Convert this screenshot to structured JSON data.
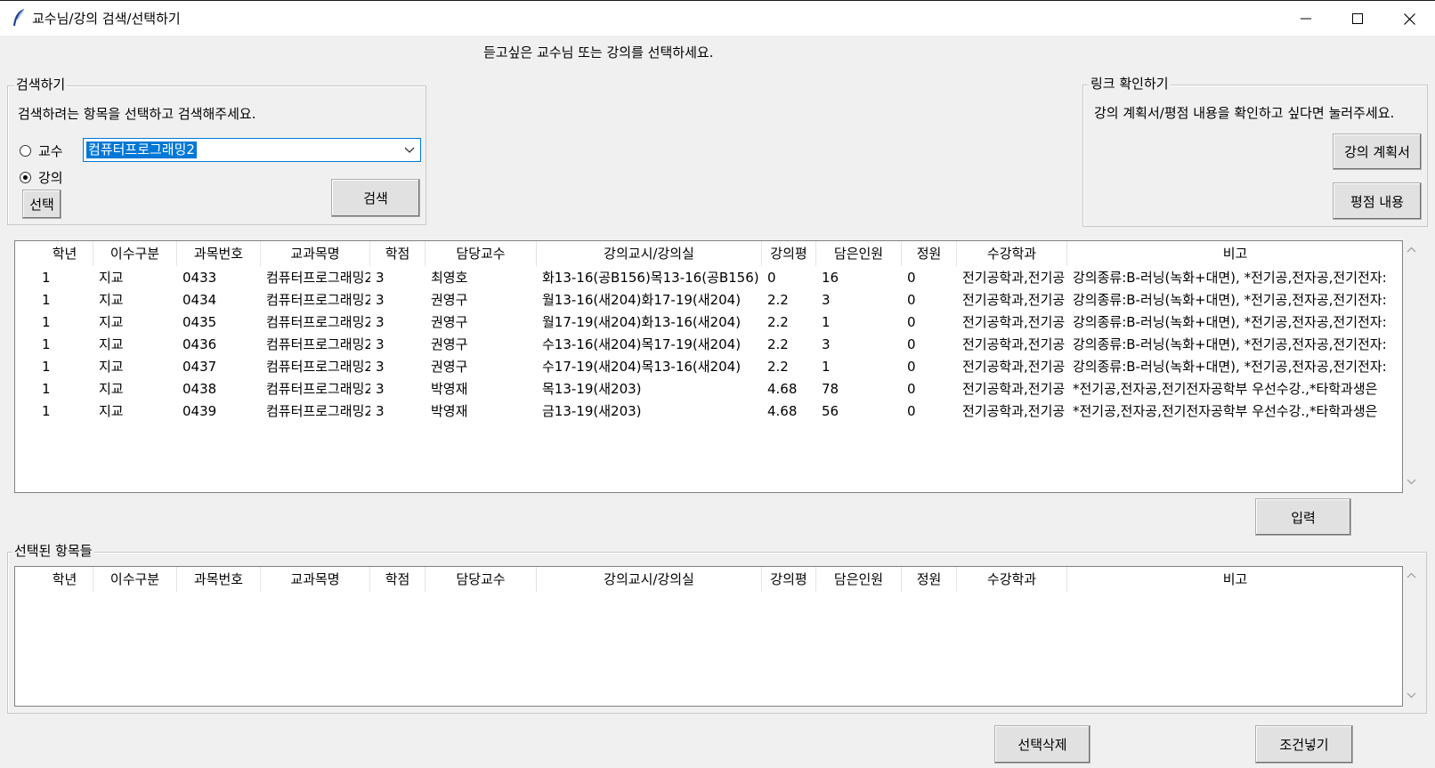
{
  "window": {
    "title": "교수님/강의 검색/선택하기",
    "minimize_glyph": "—",
    "maximize_glyph": "□",
    "close_glyph": "✕"
  },
  "instruction": "듣고싶은 교수님 또는 강의를 선택하세요.",
  "search": {
    "legend": "검색하기",
    "hint": "검색하려는 항목을 선택하고 검색해주세요.",
    "radio_professor": "교수",
    "radio_course": "강의",
    "selected_radio": "강의",
    "combo_value": "컴퓨터프로그래밍2",
    "select_button": "선택",
    "search_button": "검색"
  },
  "link": {
    "legend": "링크 확인하기",
    "hint": "강의 계획서/평점 내용을 확인하고 싶다면 눌러주세요.",
    "syllabus_button": "강의 계획서",
    "rating_button": "평점 내용"
  },
  "columns": [
    "학년",
    "이수구분",
    "과목번호",
    "교과목명",
    "학점",
    "담당교수",
    "강의교시/강의실",
    "강의평",
    "담은인원",
    "정원",
    "수강학과",
    "비고"
  ],
  "results": [
    [
      "1",
      "지교",
      "0433",
      "컴퓨터프로그래밍2",
      "3",
      "최영호",
      "화13-16(공B156)목13-16(공B156)",
      "0",
      "16",
      "0",
      "전기공학과,전기공",
      "강의종류:B-러닝(녹화+대면), *전기공,전자공,전기전자:"
    ],
    [
      "1",
      "지교",
      "0434",
      "컴퓨터프로그래밍2",
      "3",
      "권영구",
      "월13-16(새204)화17-19(새204)",
      "2.2",
      "3",
      "0",
      "전기공학과,전기공",
      "강의종류:B-러닝(녹화+대면), *전기공,전자공,전기전자:"
    ],
    [
      "1",
      "지교",
      "0435",
      "컴퓨터프로그래밍2",
      "3",
      "권영구",
      "월17-19(새204)화13-16(새204)",
      "2.2",
      "1",
      "0",
      "전기공학과,전기공",
      "강의종류:B-러닝(녹화+대면), *전기공,전자공,전기전자:"
    ],
    [
      "1",
      "지교",
      "0436",
      "컴퓨터프로그래밍2",
      "3",
      "권영구",
      "수13-16(새204)목17-19(새204)",
      "2.2",
      "3",
      "0",
      "전기공학과,전기공",
      "강의종류:B-러닝(녹화+대면), *전기공,전자공,전기전자:"
    ],
    [
      "1",
      "지교",
      "0437",
      "컴퓨터프로그래밍2",
      "3",
      "권영구",
      "수17-19(새204)목13-16(새204)",
      "2.2",
      "1",
      "0",
      "전기공학과,전기공",
      "강의종류:B-러닝(녹화+대면), *전기공,전자공,전기전자:"
    ],
    [
      "1",
      "지교",
      "0438",
      "컴퓨터프로그래밍2",
      "3",
      "박영재",
      "목13-19(새203)",
      "4.68",
      "78",
      "0",
      "전기공학과,전기공",
      "*전기공,전자공,전기전자공학부 우선수강.,*타학과생은"
    ],
    [
      "1",
      "지교",
      "0439",
      "컴퓨터프로그래밍2",
      "3",
      "박영재",
      "금13-19(새203)",
      "4.68",
      "56",
      "0",
      "전기공학과,전기공",
      "*전기공,전자공,전기전자공학부 우선수강.,*타학과생은"
    ]
  ],
  "input_button": "입력",
  "selected": {
    "legend": "선택된 항목들"
  },
  "delete_button": "선택삭제",
  "condition_button": "조건넣기",
  "colors": {
    "selection_blue": "#0078d7",
    "window_bg": "#f0f0f0"
  }
}
